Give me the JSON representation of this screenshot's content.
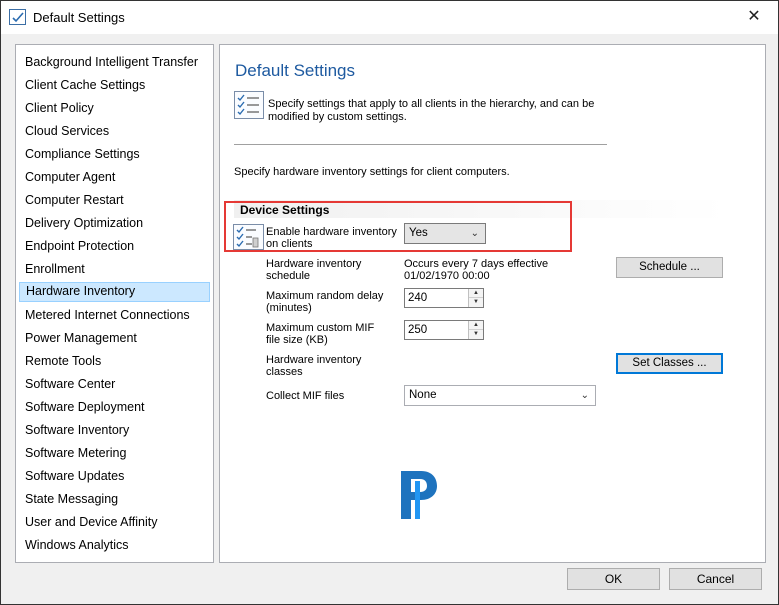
{
  "window": {
    "title": "Default Settings",
    "close_glyph": "✕"
  },
  "nav": {
    "items": [
      {
        "label": "Background Intelligent Transfer"
      },
      {
        "label": "Client Cache Settings"
      },
      {
        "label": "Client Policy"
      },
      {
        "label": "Cloud Services"
      },
      {
        "label": "Compliance Settings"
      },
      {
        "label": "Computer Agent"
      },
      {
        "label": "Computer Restart"
      },
      {
        "label": "Delivery Optimization"
      },
      {
        "label": "Endpoint Protection"
      },
      {
        "label": "Enrollment"
      },
      {
        "label": "Hardware Inventory"
      },
      {
        "label": "Metered Internet Connections"
      },
      {
        "label": "Power Management"
      },
      {
        "label": "Remote Tools"
      },
      {
        "label": "Software Center"
      },
      {
        "label": "Software Deployment"
      },
      {
        "label": "Software Inventory"
      },
      {
        "label": "Software Metering"
      },
      {
        "label": "Software Updates"
      },
      {
        "label": "State Messaging"
      },
      {
        "label": "User and Device Affinity"
      },
      {
        "label": "Windows Analytics"
      }
    ],
    "selected": "Hardware Inventory"
  },
  "panel": {
    "title": "Default Settings",
    "description": "Specify settings that apply to all clients in the hierarchy, and can be modified by custom settings.",
    "subdescription": "Specify hardware inventory settings for client computers.",
    "group_title": "Device Settings",
    "enable": {
      "label": "Enable hardware inventory on clients",
      "value": "Yes"
    },
    "schedule": {
      "label": "Hardware inventory schedule",
      "value_line1": "Occurs every 7 days effective",
      "value_line2": "01/02/1970 00:00",
      "button": "Schedule ..."
    },
    "random_delay": {
      "label": "Maximum random delay (minutes)",
      "value": "240"
    },
    "mif_size": {
      "label": "Maximum custom MIF file size (KB)",
      "value": "250"
    },
    "classes": {
      "label": "Hardware inventory classes",
      "button": "Set Classes ..."
    },
    "collect_mif": {
      "label": "Collect MIF files",
      "value": "None"
    },
    "watermark_letter": "P"
  },
  "footer": {
    "ok": "OK",
    "cancel": "Cancel"
  },
  "colors": {
    "accent": "#1e5aa0",
    "selection": "#cce8ff",
    "highlight_box": "#e53935",
    "watermark": "#1e73be"
  }
}
